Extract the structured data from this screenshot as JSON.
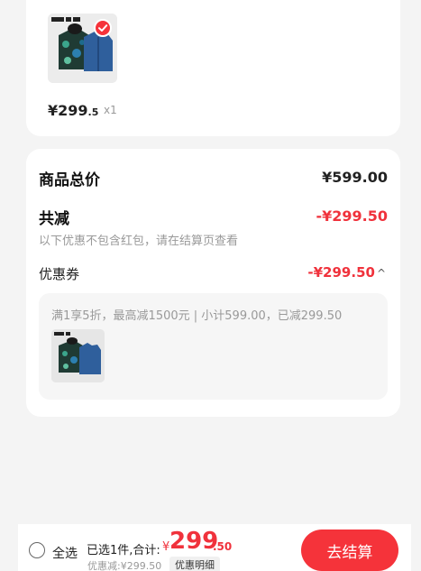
{
  "product": {
    "price_int": "¥299",
    "price_dec": ".5",
    "quantity": "x1",
    "thumbnail_icon": "jacket-set-image",
    "selected_icon": "check-circle-icon"
  },
  "summary": {
    "total_label": "商品总价",
    "total_value": "¥599.00",
    "reduction_label": "共减",
    "reduction_value": "-¥299.50",
    "hint": "以下优惠不包含红包，请在结算页查看",
    "coupon_label": "优惠券",
    "coupon_value": "-¥299.50",
    "coupon_chevron": "^",
    "coupon_desc": "满1享5折，最高减1500元 | 小计599.00，已减299.50"
  },
  "footer": {
    "select_all": "全选",
    "selected_text": "已选1件,合计:",
    "currency": "¥",
    "total_int": "299",
    "total_dec": ".50",
    "discount_text": "优惠减:¥299.50",
    "detail_label": "优惠明细",
    "checkout_label": "去结算"
  },
  "colors": {
    "accent": "#f5333a",
    "price_red": "#f0323c",
    "background": "#f4f4f4"
  }
}
